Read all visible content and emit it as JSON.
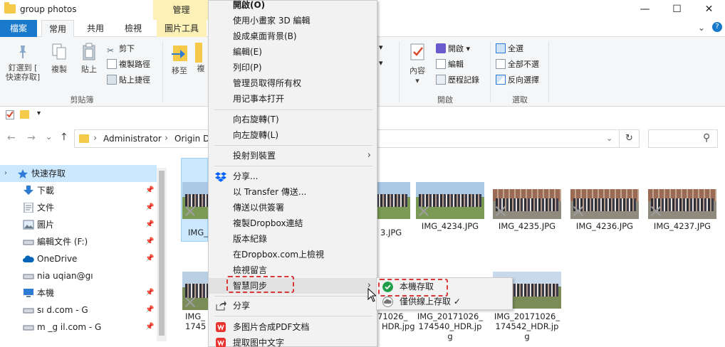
{
  "window": {
    "title": "group photos",
    "contextual_tab_header": "管理",
    "minimize_glyph": "—",
    "maximize_glyph": "☐",
    "close_glyph": "✕"
  },
  "tabs": {
    "file": "檔案",
    "home": "常用",
    "share": "共用",
    "view": "檢視",
    "picture_tools": "圖片工具",
    "expand_glyph": "⌄",
    "help_glyph": "?"
  },
  "ribbon": {
    "pin_label_1": "釘選到 [",
    "pin_label_2": "快速存取]",
    "copy_label": "複製",
    "paste_label": "貼上",
    "cut_label": "剪下",
    "copy_path_label": "複製路徑",
    "paste_shortcut_label": "貼上捷徑",
    "clipboard_group": "剪貼簿",
    "move_to_label": "移至",
    "copy_to_label_partial": "複",
    "dropdown_glyph": "▾",
    "open_big_label": "內容",
    "open_small_label": "開啟",
    "edit_label": "編輯",
    "history_label": "歷程記錄",
    "open_group": "開啟",
    "select_all_label": "全選",
    "select_none_label": "全部不選",
    "invert_selection_label": "反向選擇",
    "select_group": "選取"
  },
  "qat": {
    "dropdown_glyph": "▾"
  },
  "address": {
    "back_glyph": "←",
    "forward_glyph": "→",
    "recent_glyph": "⌄",
    "up_glyph": "↑",
    "sep_glyph": "›",
    "crumbs": [
      "Administrator",
      "Origin D"
    ],
    "refresh_glyph": "↻",
    "search_glyph": "⚲",
    "addr_dropdown_glyph": "⌄"
  },
  "nav": {
    "collapse_glyph": "›",
    "pin_glyph": "📌",
    "items": [
      {
        "label": "快速存取"
      },
      {
        "label": "下載"
      },
      {
        "label": "文件"
      },
      {
        "label": "圖片"
      },
      {
        "label": "編輯文件 (F:)"
      },
      {
        "label": "OneDrive"
      },
      {
        "label": "nia          uqian@gı"
      },
      {
        "label": "本機"
      },
      {
        "label": "sı           d.com - G"
      },
      {
        "label": "m        _g     il.com - G"
      }
    ]
  },
  "files": {
    "row1": [
      "IMG_",
      "3.JPG",
      "IMG_4234.JPG",
      "IMG_4235.JPG",
      "IMG_4236.JPG",
      "IMG_4237.JPG"
    ],
    "row2_left": [
      "IMG_",
      "1745"
    ],
    "row2_mid": [
      "71026_",
      "HDR.jpg"
    ],
    "row2_a": [
      "IMG_20171026_",
      "174540_HDR.jp",
      "g"
    ],
    "row2_b": [
      "IMG_20171026_",
      "174542_HDR.jp",
      "g"
    ]
  },
  "context_menu": {
    "open": "開啟(O)",
    "paint3d": "使用小畫家 3D 編輯",
    "set_wallpaper": "設成桌面背景(B)",
    "edit": "編輯(E)",
    "print": "列印(P)",
    "take_ownership": "管理员取得所有权",
    "open_notepad": "用记事本打开",
    "rotate_right": "向右旋轉(T)",
    "rotate_left": "向左旋轉(L)",
    "cast_to_device": "投射到裝置",
    "dropbox_share": "分享...",
    "transfer_send": "以 Transfer 傳送...",
    "send_signature": "傳送以供簽署",
    "copy_dropbox_link": "複製Dropbox連結",
    "version_history": "版本紀錄",
    "view_on_dropbox": "在Dropbox.com上檢視",
    "view_comments": "檢視留言",
    "smart_sync": "智慧同步",
    "share": "分享",
    "pdf_merge": "多图片合成PDF文档",
    "extract_text": "提取图中文字",
    "arrow_glyph": "›"
  },
  "submenu": {
    "local": "本機存取",
    "online_only": "僅供線上存取 ✓"
  },
  "colors": {
    "file_tab": "#1979ca",
    "contextual_tab": "#fdf1b8",
    "selection": "#cce8ff",
    "highlight_box": "#d93636",
    "dropbox_blue": "#0061fe",
    "wps_red": "#e8322d",
    "check_green": "#1f9e4a"
  }
}
